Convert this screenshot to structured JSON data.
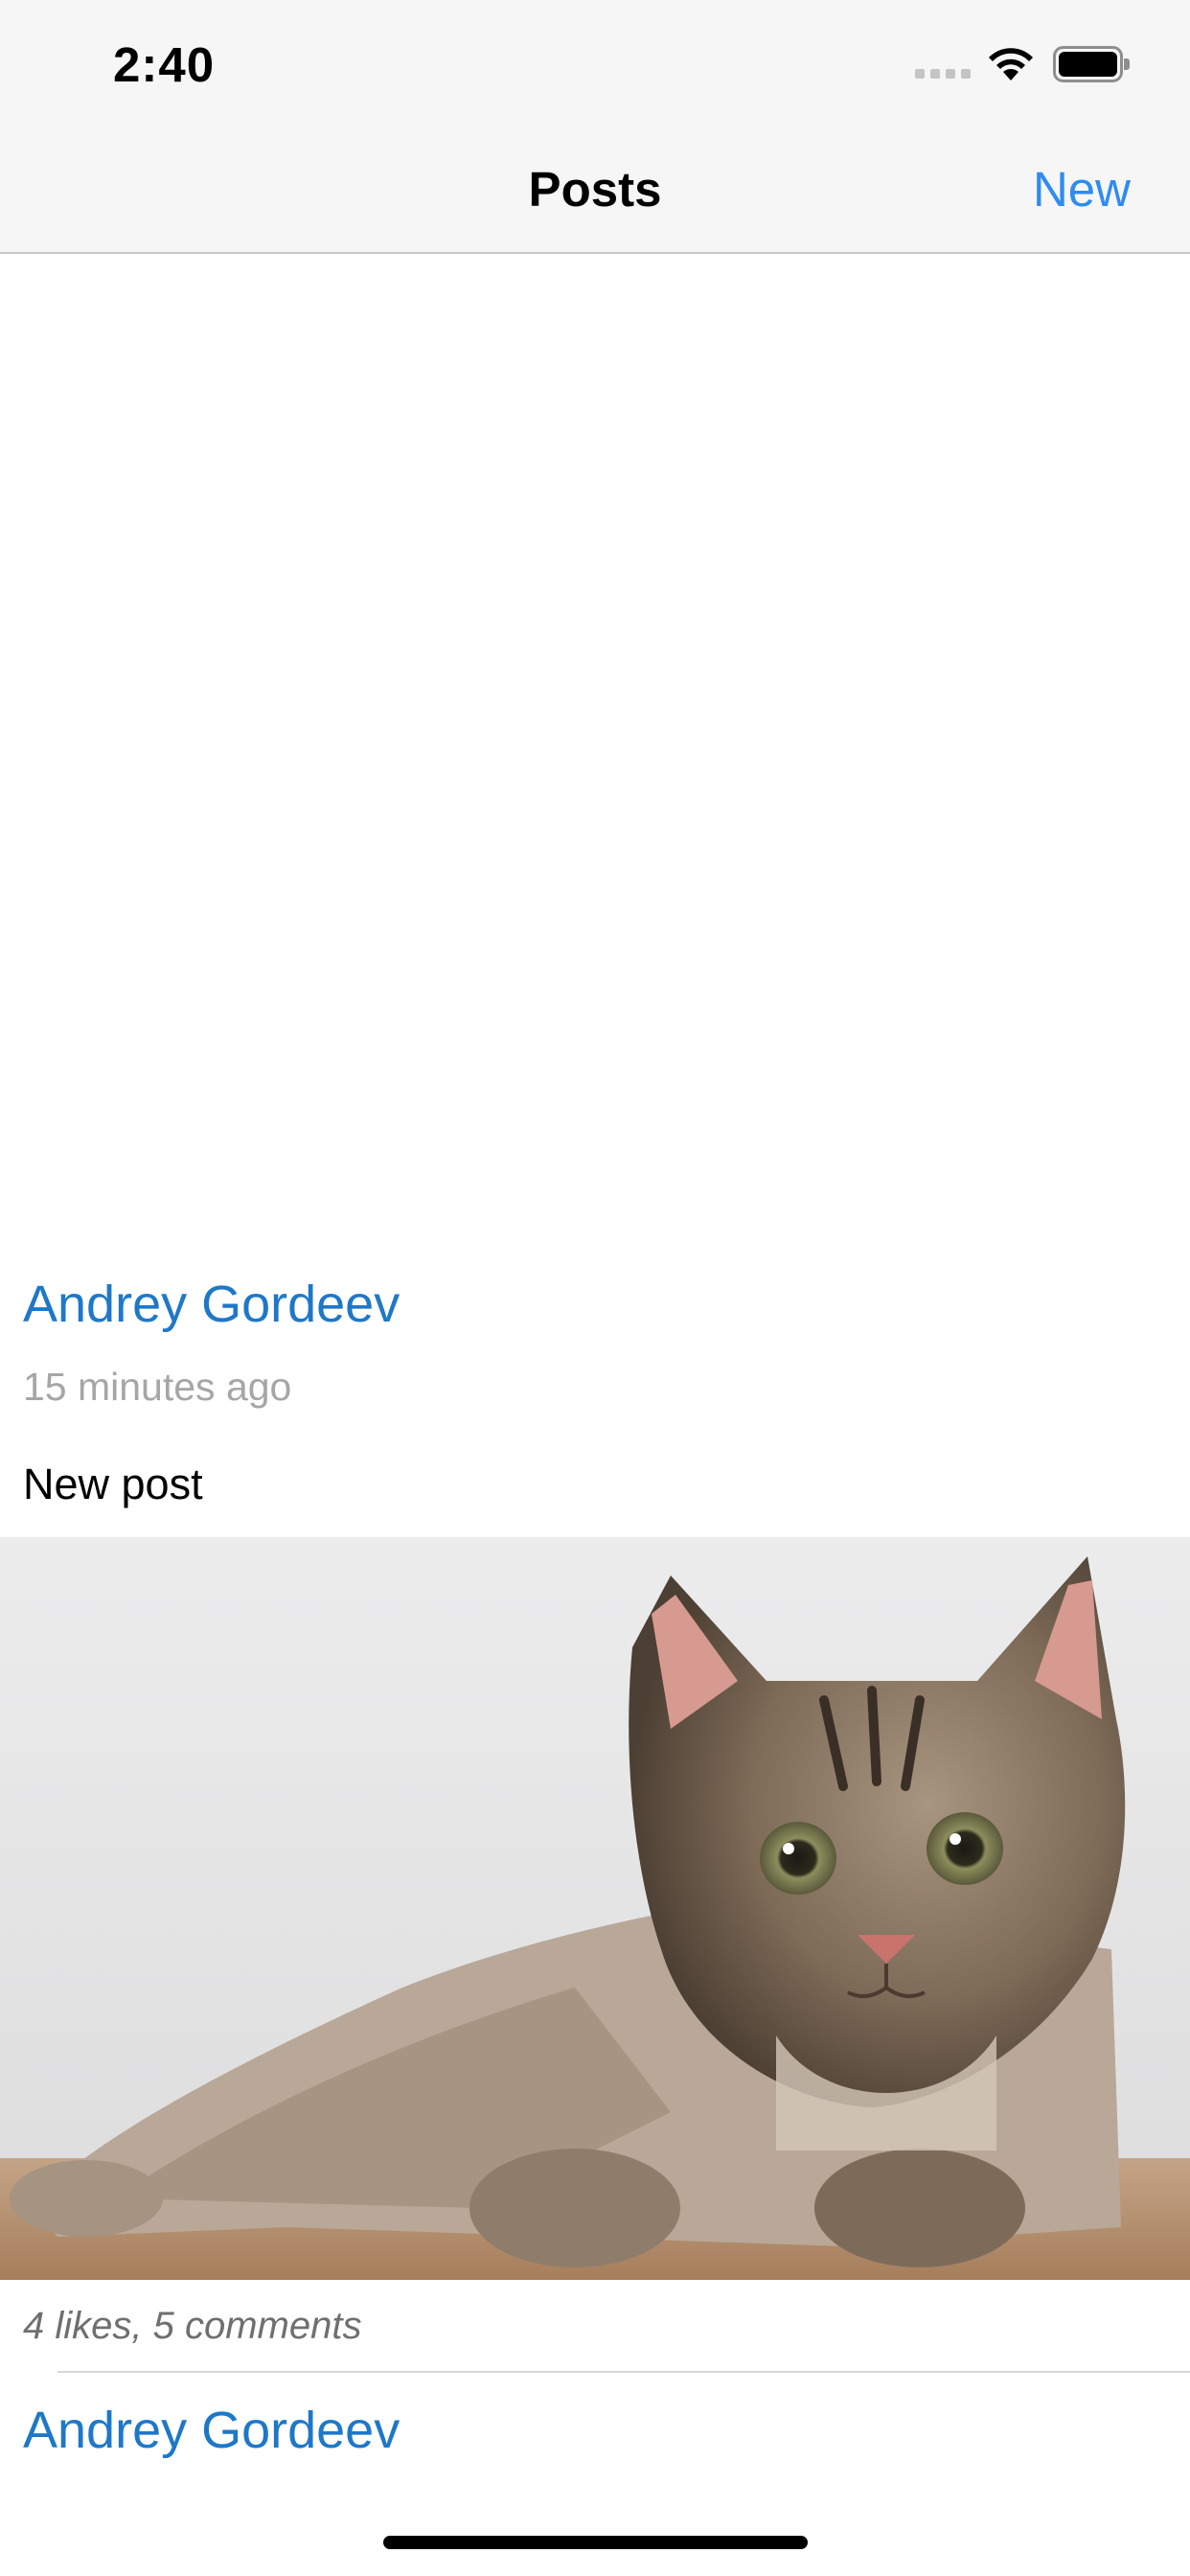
{
  "status_bar": {
    "time": "2:40"
  },
  "nav": {
    "title": "Posts",
    "new_label": "New",
    "accent_color": "#2f8cf0"
  },
  "posts": [
    {
      "author": "Andrey Gordeev",
      "time_ago": "15 minutes ago",
      "text": "New post",
      "stats": "4 likes, 5 comments"
    },
    {
      "author": "Andrey Gordeev"
    }
  ],
  "colors": {
    "author": "#1e78c8",
    "secondary_text": "#a6a6a6"
  }
}
